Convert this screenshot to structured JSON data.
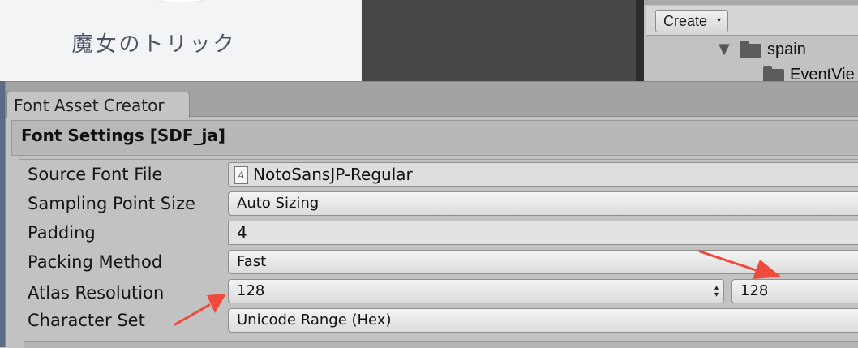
{
  "background": {
    "game_title": "魔女のトリック",
    "project": {
      "create_label": "Create",
      "create_caret": "▾",
      "tree_caret": "▼",
      "folder_1": "spain",
      "folder_2": "EventVie"
    }
  },
  "window": {
    "tab_title": "Font Asset Creator",
    "section_title": "Font Settings [SDF_ja]"
  },
  "settings": {
    "source_font_file": {
      "label": "Source Font File",
      "value": "NotoSansJP-Regular",
      "icon_glyph": "A"
    },
    "sampling_point_size": {
      "label": "Sampling Point Size",
      "value": "Auto Sizing"
    },
    "padding": {
      "label": "Padding",
      "value": "4"
    },
    "packing_method": {
      "label": "Packing Method",
      "value": "Fast"
    },
    "atlas_resolution": {
      "label": "Atlas Resolution",
      "width": "128",
      "height": "128",
      "stepper_glyph": "▲▼"
    },
    "character_set": {
      "label": "Character Set",
      "value": "Unicode Range (Hex)"
    }
  },
  "annotations": {
    "arrow_color": "#f04a3c",
    "count": 2
  },
  "colors": {
    "panel": "#c2c2c2",
    "tabbar": "#a3a3a3",
    "dark_scene": "#474747"
  }
}
